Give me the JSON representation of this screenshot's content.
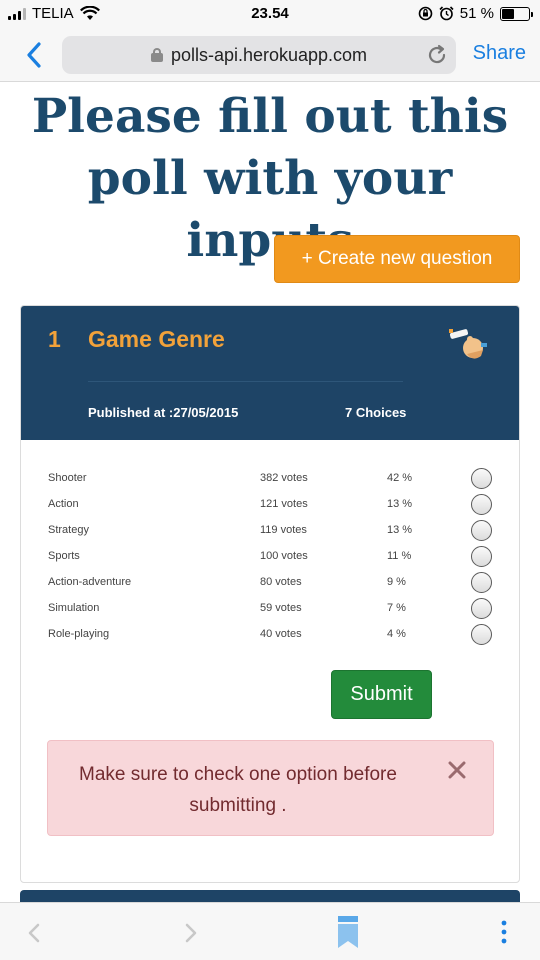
{
  "status_bar": {
    "carrier": "TELIA",
    "time": "23.54",
    "battery_text": "51 %",
    "battery_level": 0.51,
    "icons": [
      "signal-icon",
      "wifi-icon",
      "rotation-lock-icon",
      "alarm-icon",
      "battery-icon"
    ]
  },
  "browser": {
    "url": "polls-api.herokuapp.com",
    "share_label": "Share",
    "icons": [
      "back-chevron-icon",
      "lock-icon",
      "reload-icon"
    ]
  },
  "page": {
    "title": "Please fill out this poll with your inputs",
    "create_button_label": "+ Create new question"
  },
  "poll": {
    "number": "1",
    "title": "Game Genre",
    "published": "Published at :27/05/2015",
    "choices_count": "7 Choices",
    "icon": "hand-pointing-icon",
    "options": [
      {
        "name": "Shooter",
        "votes": "382 votes",
        "percent": "42 %"
      },
      {
        "name": "Action",
        "votes": "121 votes",
        "percent": "13 %"
      },
      {
        "name": "Strategy",
        "votes": "119 votes",
        "percent": "13 %"
      },
      {
        "name": "Sports",
        "votes": "100 votes",
        "percent": "11 %"
      },
      {
        "name": "Action-adventure",
        "votes": "80 votes",
        "percent": "9 %"
      },
      {
        "name": "Simulation",
        "votes": "59 votes",
        "percent": "7 %"
      },
      {
        "name": "Role-playing",
        "votes": "40 votes",
        "percent": "4 %"
      }
    ],
    "submit_label": "Submit"
  },
  "alert": {
    "message": "Make sure to check one option before submitting ."
  },
  "toolbar": {
    "icons": [
      "back-arrow-icon",
      "forward-arrow-icon",
      "bookmark-icon",
      "more-dots-icon"
    ]
  },
  "colors": {
    "title": "#1c4a6c",
    "header_bg": "#1e4466",
    "accent_orange": "#f2991f",
    "submit_green": "#238b3b",
    "alert_bg": "#f8d7da",
    "alert_text": "#722b2f",
    "link_blue": "#1a7fe0"
  }
}
